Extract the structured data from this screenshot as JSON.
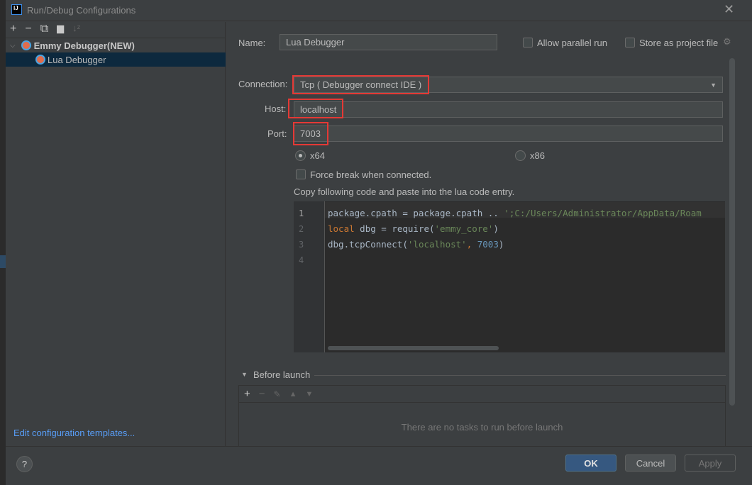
{
  "window": {
    "title": "Run/Debug Configurations"
  },
  "sidebar": {
    "toolbar": [
      "add-icon",
      "remove-icon",
      "copy-icon",
      "new-folder-icon",
      "sort-icon"
    ],
    "tree": [
      {
        "label": "Emmy Debugger(NEW)",
        "expanded": true
      },
      {
        "label": "Lua Debugger",
        "selected": true
      }
    ],
    "edit_templates": "Edit configuration templates..."
  },
  "form": {
    "name_label": "Name:",
    "name_value": "Lua Debugger",
    "allow_parallel": "Allow parallel run",
    "allow_parallel_checked": false,
    "store_project": "Store as project file",
    "store_project_checked": false,
    "connection_label": "Connection:",
    "connection_value": "Tcp ( Debugger connect IDE )",
    "host_label": "Host:",
    "host_value": "localhost",
    "port_label": "Port:",
    "port_value": "7003",
    "arch_x64": "x64",
    "arch_x86": "x86",
    "arch_selected": "x64",
    "force_break": "Force break when connected.",
    "force_break_checked": false,
    "copy_hint": "Copy following code and paste into the lua code entry."
  },
  "code": {
    "line_numbers": [
      "1",
      "2",
      "3",
      "4"
    ],
    "l1a": "package.cpath = package.cpath .. ",
    "l1b": "';C:/Users/Administrator/AppData/Roam",
    "l2a": "local",
    "l2b": " dbg = require(",
    "l2c": "'emmy_core'",
    "l2d": ")",
    "l3a": "dbg.tcpConnect(",
    "l3b": "'localhost'",
    "l3c": ", ",
    "l3d": "7003",
    "l3e": ")"
  },
  "before_launch": {
    "title": "Before launch",
    "empty": "There are no tasks to run before launch"
  },
  "buttons": {
    "ok": "OK",
    "cancel": "Cancel",
    "apply": "Apply",
    "help": "?"
  },
  "colors": {
    "accent": "#365880",
    "highlight": "#e53935",
    "selection": "#0d293e"
  }
}
